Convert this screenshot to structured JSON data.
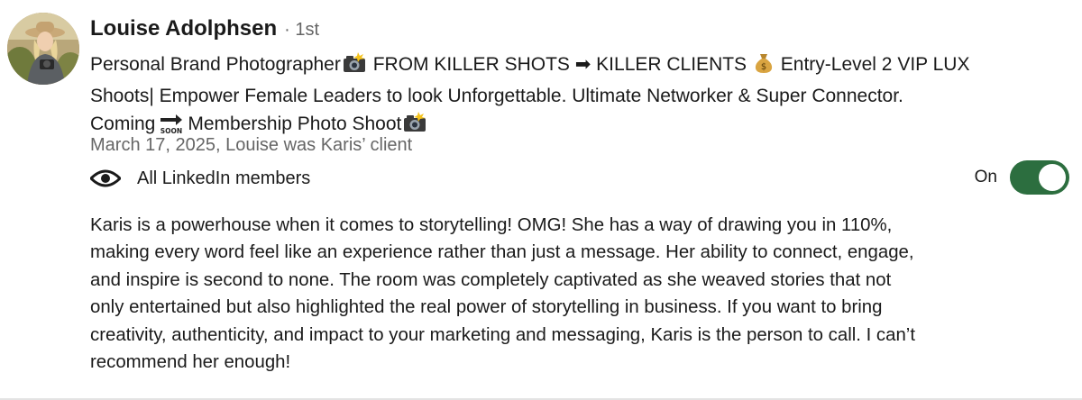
{
  "recommendation": {
    "author": {
      "name": "Louise Adolphsen",
      "degree": "· 1st"
    },
    "headline": {
      "line1_a": "Personal Brand Photographer",
      "line1_b": "FROM KILLER SHOTS ➡ KILLER CLIENTS",
      "line1_c": "Entry-Level 2 VIP LUX",
      "line2": "Shoots| Empower Female Leaders to look Unforgettable. Ultimate Networker & Super Connector.",
      "line3_a": "Coming",
      "line3_b": "Membership Photo Shoot",
      "soon_label": "SOON"
    },
    "meta": "March 17, 2025, Louise was Karis’ client",
    "visibility": {
      "label": "All LinkedIn members",
      "icon": "eye-icon"
    },
    "toggle": {
      "label": "On",
      "state": "on",
      "color": "#2c6e3f"
    },
    "body_lines": [
      "Karis is a powerhouse when it comes to storytelling! OMG! She has a way of drawing you in 110%,",
      "making every word feel like an experience rather than just a message. Her ability to connect, engage,",
      "and inspire is second to none. The room was completely captivated as she weaved stories that not",
      "only entertained but also highlighted the real power of storytelling in business. If you want to bring",
      "creativity, authenticity, and impact to your marketing and messaging, Karis is the person to call. I can’t",
      "recommend her enough!"
    ]
  }
}
